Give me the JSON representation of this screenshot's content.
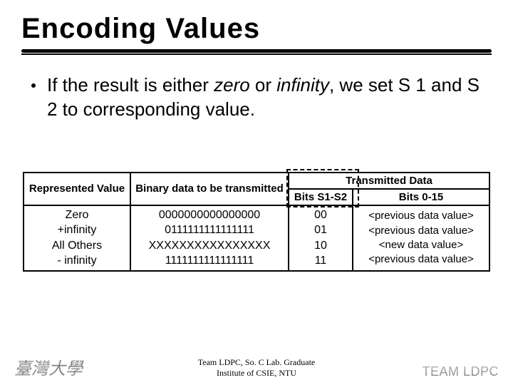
{
  "title": "Encoding Values",
  "bullet": {
    "prefix": "If the result is either ",
    "italic1": "zero",
    "mid": " or ",
    "italic2": "infinity",
    "suffix": ", we set S 1 and S 2 to corresponding value."
  },
  "table": {
    "headers": {
      "represented": "Represented Value",
      "binary": "Binary data to be transmitted",
      "transmitted": "Transmitted Data",
      "bits_s1s2": "Bits S1-S2",
      "bits_0_15": "Bits 0-15"
    },
    "rows": {
      "rep": [
        "Zero",
        "+infinity",
        "All Others",
        "- infinity"
      ],
      "bin": [
        "0000000000000000",
        "0111111111111111",
        "XXXXXXXXXXXXXXXX",
        "1111111111111111"
      ],
      "s12": [
        "00",
        "01",
        "10",
        "11"
      ],
      "b015": [
        "<previous data value>",
        "<previous data value>",
        "<new data value>",
        "<previous data value>"
      ]
    }
  },
  "footer": {
    "line1": "Team LDPC, So. C Lab. Graduate",
    "line2": "Institute of CSIE, NTU",
    "left_logo": "臺灣大學",
    "right_logo": "TEAM LDPC"
  }
}
